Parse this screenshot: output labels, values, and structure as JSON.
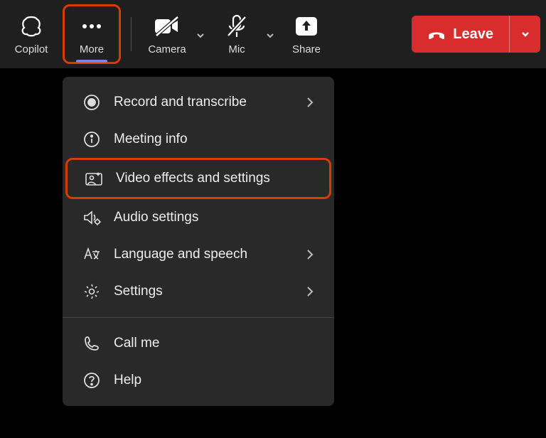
{
  "toolbar": {
    "copilot_label": "Copilot",
    "more_label": "More",
    "camera_label": "Camera",
    "mic_label": "Mic",
    "share_label": "Share",
    "leave_label": "Leave"
  },
  "menu": {
    "record_label": "Record and transcribe",
    "meeting_info_label": "Meeting info",
    "video_effects_label": "Video effects and settings",
    "audio_settings_label": "Audio settings",
    "language_label": "Language and speech",
    "settings_label": "Settings",
    "call_me_label": "Call me",
    "help_label": "Help"
  },
  "colors": {
    "annotation": "#d83b01",
    "leave": "#d92c2c",
    "accent": "#7b83eb"
  }
}
